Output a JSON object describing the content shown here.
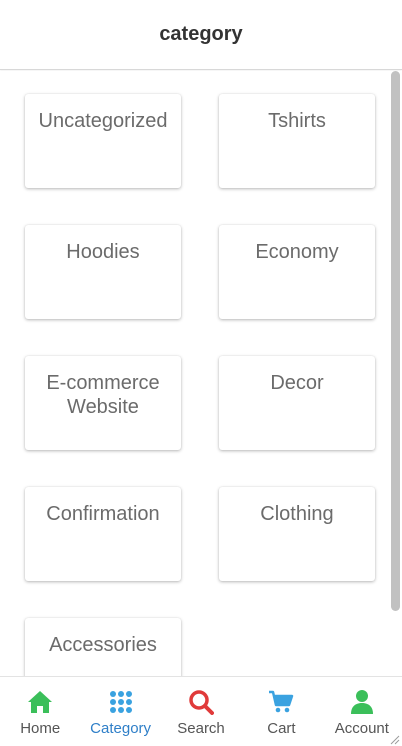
{
  "header": {
    "title": "category"
  },
  "categories": [
    "Uncategorized",
    "Tshirts",
    "Hoodies",
    "Economy",
    "E-commerce Website",
    "Decor",
    "Confirmation",
    "Clothing",
    "Accessories"
  ],
  "tabs": [
    {
      "label": "Home",
      "icon": "home-icon",
      "color": "#3bbf5a"
    },
    {
      "label": "Category",
      "icon": "grid-dots-icon",
      "color": "#3aa2e0",
      "active": true
    },
    {
      "label": "Search",
      "icon": "search-icon",
      "color": "#e03a3a"
    },
    {
      "label": "Cart",
      "icon": "cart-icon",
      "color": "#3aa2e0"
    },
    {
      "label": "Account",
      "icon": "person-icon",
      "color": "#3bbf5a"
    }
  ],
  "colors": {
    "active_tab_text": "#2f7fc8",
    "card_text": "#6b6b6b",
    "title_text": "#333333"
  }
}
